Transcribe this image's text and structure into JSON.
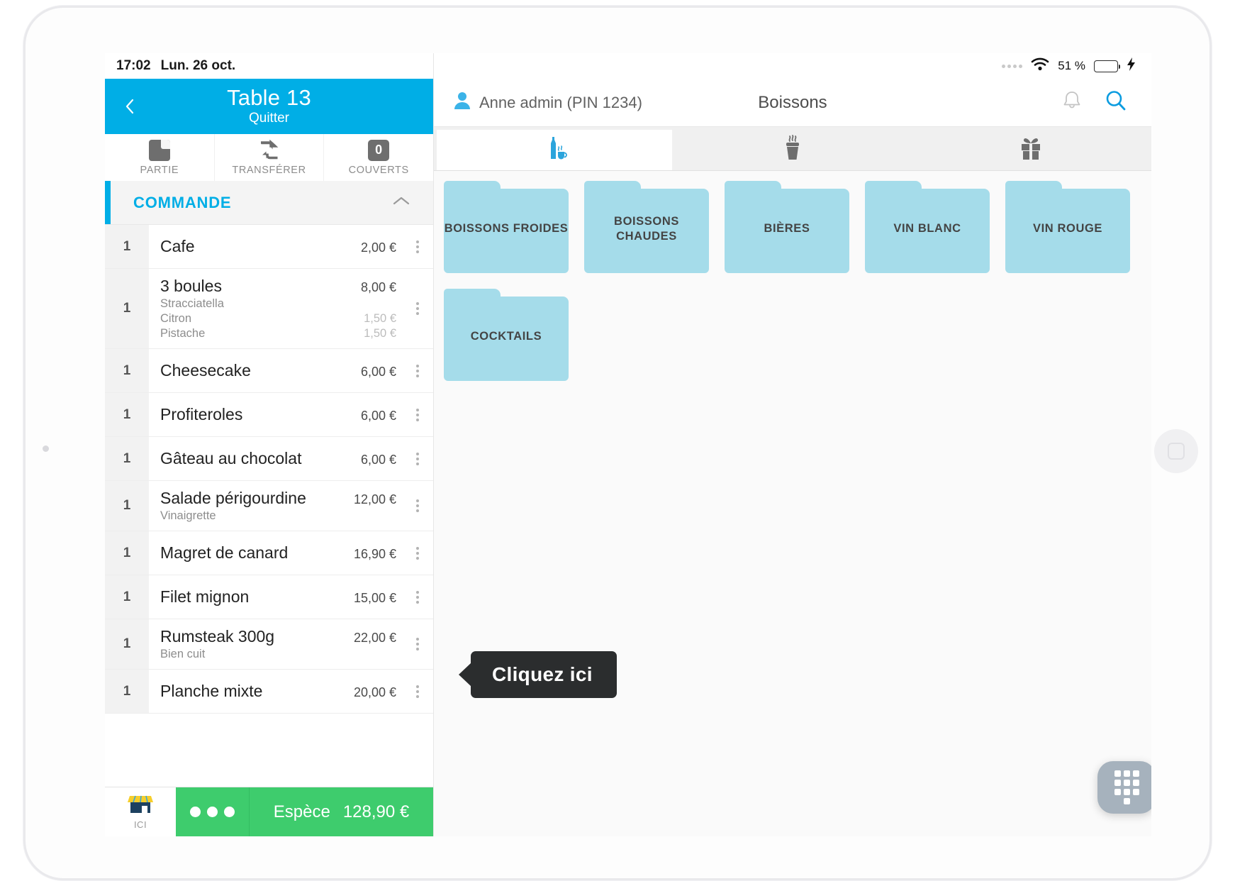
{
  "status_bar_left": {
    "time": "17:02",
    "date": "Lun. 26 oct."
  },
  "status_bar_right": {
    "battery_percent": "51 %",
    "signal_icon": "signal-dots-icon",
    "wifi_icon": "wifi-icon",
    "battery_icon": "battery-icon",
    "charging_icon": "charging-bolt-icon"
  },
  "order_panel": {
    "back_icon": "back-chevron-icon",
    "title": "Table 13",
    "subtitle": "Quitter",
    "actions": [
      {
        "label": "PARTIE",
        "icon": "split-order-icon",
        "value": ""
      },
      {
        "label": "TRANSFÉRER",
        "icon": "transfer-arrows-icon",
        "value": ""
      },
      {
        "label": "COUVERTS",
        "icon": "covers-badge-icon",
        "value": "0"
      }
    ],
    "section_title": "COMMANDE",
    "collapse_icon": "chevron-up-icon",
    "items": [
      {
        "qty": "1",
        "name": "Cafe",
        "price": "2,00 €",
        "options": []
      },
      {
        "qty": "1",
        "name": "3 boules",
        "price": "8,00 €",
        "options": [
          {
            "name": "Stracciatella",
            "price": ""
          },
          {
            "name": "Citron",
            "price": "1,50 €"
          },
          {
            "name": "Pistache",
            "price": "1,50 €"
          }
        ]
      },
      {
        "qty": "1",
        "name": "Cheesecake",
        "price": "6,00 €",
        "options": []
      },
      {
        "qty": "1",
        "name": "Profiteroles",
        "price": "6,00 €",
        "options": []
      },
      {
        "qty": "1",
        "name": "Gâteau au chocolat",
        "price": "6,00 €",
        "options": []
      },
      {
        "qty": "1",
        "name": "Salade périgourdine",
        "price": "12,00 €",
        "options": [
          {
            "name": "Vinaigrette",
            "price": ""
          }
        ]
      },
      {
        "qty": "1",
        "name": "Magret de canard",
        "price": "16,90 €",
        "options": []
      },
      {
        "qty": "1",
        "name": "Filet mignon",
        "price": "15,00 €",
        "options": []
      },
      {
        "qty": "1",
        "name": "Rumsteak 300g",
        "price": "22,00 €",
        "options": [
          {
            "name": "Bien cuit",
            "price": ""
          }
        ]
      },
      {
        "qty": "1",
        "name": "Planche mixte",
        "price": "20,00 €",
        "options": []
      }
    ],
    "row_menu_icon": "kebab-menu-icon",
    "footer": {
      "shop_icon": "storefront-icon",
      "shop_label": "ICI",
      "more_icon": "three-dots-icon",
      "pay_method": "Espèce",
      "pay_total": "128,90 €"
    }
  },
  "catalog_panel": {
    "user_icon": "user-avatar-icon",
    "user": "Anne admin (PIN 1234)",
    "title": "Boissons",
    "bell_icon": "bell-icon",
    "search_icon": "search-icon",
    "tabs": [
      {
        "icon": "drinks-bottle-cup-icon",
        "active": true
      },
      {
        "icon": "hot-pot-food-icon",
        "active": false
      },
      {
        "icon": "gift-box-icon",
        "active": false
      }
    ],
    "folders": [
      {
        "label": "BOISSONS FROIDES"
      },
      {
        "label": "BOISSONS CHAUDES"
      },
      {
        "label": "BIÈRES"
      },
      {
        "label": "VIN BLANC"
      },
      {
        "label": "VIN ROUGE"
      },
      {
        "label": "COCKTAILS"
      }
    ],
    "keypad_icon": "dialpad-icon"
  },
  "tooltip": {
    "text": "Cliquez ici"
  },
  "colors": {
    "brand_blue": "#00AEE6",
    "folder_blue": "#A5DCEA",
    "pay_green": "#3ECC6D",
    "tooltip_dark": "#2b2d2e"
  }
}
